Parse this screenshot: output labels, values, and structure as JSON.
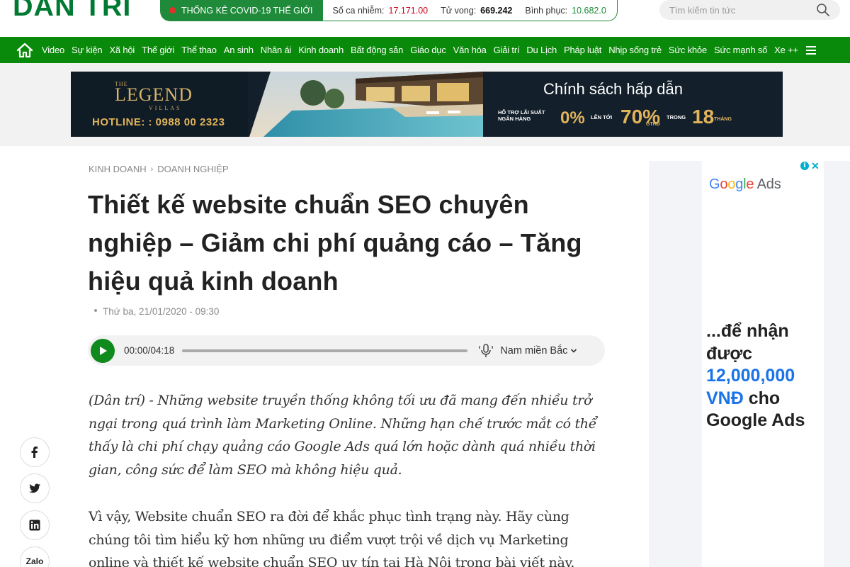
{
  "header": {
    "logo": "DÂN TRÍ",
    "covid": {
      "title": "THỐNG KÊ COVID-19  THẾ GIỚI",
      "cases_label": "Số ca nhiễm:",
      "cases_value": "17.171.00",
      "deaths_label": "Tử vong:",
      "deaths_value": "669.242",
      "recovered_label": "Bình phục:",
      "recovered_value": "10.682.0"
    },
    "search": {
      "placeholder": "Tìm kiếm tin tức"
    }
  },
  "nav": {
    "items": [
      "Video",
      "Sự kiện",
      "Xã hội",
      "Thế giới",
      "Thể thao",
      "An sinh",
      "Nhân ái",
      "Kinh doanh",
      "Bất động sản",
      "Giáo dục",
      "Văn hóa",
      "Giải trí",
      "Du Lịch",
      "Pháp luật",
      "Nhịp sống trẻ",
      "Sức khỏe",
      "Sức mạnh số",
      "Xe ++"
    ]
  },
  "banner": {
    "brand_the": "THE",
    "brand_name": "LEGEND",
    "brand_sub": "VILLAS",
    "hotline": "HOTLINE: : 0988 00 2323",
    "headline": "Chính sách hấp dẫn",
    "support_line1": "HỖ TRỢ LÃI SUẤT",
    "support_line2": "NGÂN HÀNG",
    "rate": "0%",
    "up_to": "LÊN TỚI",
    "percent": "70%",
    "gthd": "GTHĐ",
    "within": "TRONG",
    "months_value": "18",
    "months_label": "THÁNG"
  },
  "article": {
    "breadcrumb": [
      "KINH DOANH",
      "DOANH NGHIỆP"
    ],
    "title": "Thiết kế website chuẩn SEO chuyên nghiệp – Giảm chi phí quảng cáo – Tăng hiệu quả kinh doanh",
    "date": "Thứ ba, 21/01/2020 - 09:30",
    "player": {
      "time": "00:00/04:18",
      "progress": 0,
      "voice": "Nam miền Bắc"
    },
    "lead": "(Dân trí) - Những website truyền thống không tối ưu đã mang đến nhiều trở ngại trong quá trình làm Marketing Online. Những hạn chế trước mắt có thể thấy là chi phí chạy quảng cáo Google Ads quá lớn hoặc dành quá nhiều thời gian, công sức để làm SEO mà không hiệu quả.",
    "paragraph1": "Vì vậy, Website chuẩn SEO ra đời để khắc phục tình trạng này. Hãy cùng chúng tôi tìm hiểu kỹ hơn những ưu điểm vượt trội về dịch vụ Marketing online và thiết kế website chuẩn SEO uy tín tại Hà Nội trong bài viết này."
  },
  "share": {
    "zalo": "Zalo"
  },
  "ad": {
    "logo": "Google Ads",
    "copy_line1": "...để nhận được",
    "copy_amount": "12,000,000 VNĐ",
    "copy_line2": "cho Google Ads"
  },
  "colors": {
    "brand_green": "#0a8a0a",
    "play_green": "#0f8a1d",
    "covid_red": "#d0021b",
    "ad_blue": "#1a73e8"
  }
}
